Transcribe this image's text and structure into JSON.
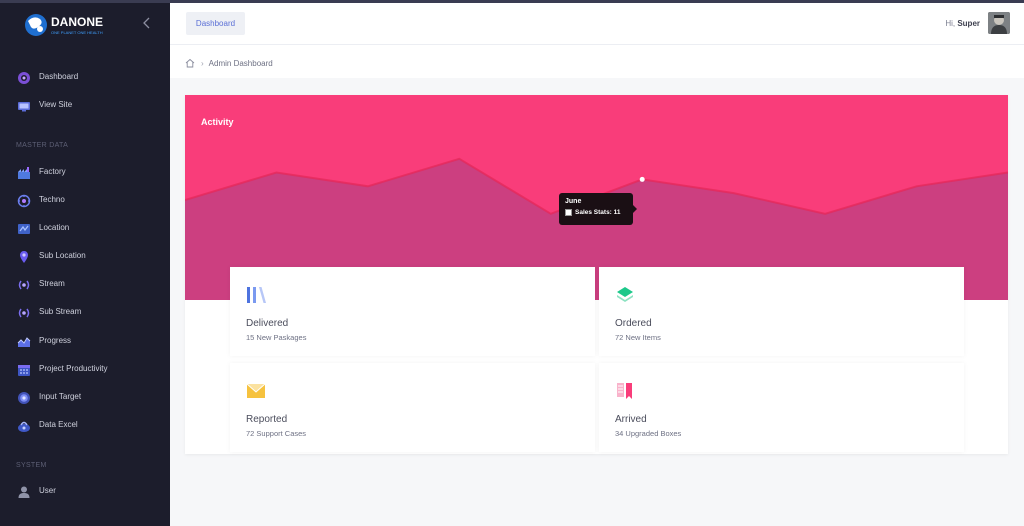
{
  "brand": {
    "name": "DANONE",
    "tagline": "ONE PLANET ONE HEALTH"
  },
  "sidebar": {
    "items": [
      {
        "label": "Dashboard",
        "icon": "dashboard-icon"
      },
      {
        "label": "View Site",
        "icon": "monitor-icon"
      }
    ],
    "sections": [
      {
        "label": "MASTER DATA",
        "items": [
          {
            "label": "Factory",
            "icon": "factory-icon"
          },
          {
            "label": "Techno",
            "icon": "techno-icon"
          },
          {
            "label": "Location",
            "icon": "location-icon"
          },
          {
            "label": "Sub Location",
            "icon": "map-pin-icon"
          },
          {
            "label": "Stream",
            "icon": "stream-icon"
          },
          {
            "label": "Sub Stream",
            "icon": "sub-stream-icon"
          },
          {
            "label": "Progress",
            "icon": "progress-chart-icon"
          },
          {
            "label": "Project Productivity",
            "icon": "calendar-icon"
          },
          {
            "label": "Input Target",
            "icon": "target-icon"
          },
          {
            "label": "Data Excel",
            "icon": "data-excel-icon"
          }
        ]
      },
      {
        "label": "SYSTEM",
        "items": [
          {
            "label": "User",
            "icon": "user-icon"
          }
        ]
      }
    ]
  },
  "topbar": {
    "tab_label": "Dashboard",
    "greeting_prefix": "Hi,",
    "user_name": "Super"
  },
  "breadcrumb": {
    "current": "Admin Dashboard"
  },
  "activity": {
    "title": "Activity",
    "tooltip": {
      "title": "June",
      "series_label": "Sales Stats: 11"
    },
    "accent_color": "#f93d7a"
  },
  "stats": [
    {
      "title": "Delivered",
      "subtitle": "15 New Paskages",
      "icon": "bars-icon",
      "color": "#4e73df"
    },
    {
      "title": "Ordered",
      "subtitle": "72 New Items",
      "icon": "diamond-stack-icon",
      "color": "#1cc88a"
    },
    {
      "title": "Reported",
      "subtitle": "72 Support Cases",
      "icon": "envelope-icon",
      "color": "#f6c23e"
    },
    {
      "title": "Arrived",
      "subtitle": "34 Upgraded Boxes",
      "icon": "bookmark-icon",
      "color": "#f93d7a"
    }
  ],
  "chart_data": {
    "type": "area",
    "x": [
      0,
      1,
      2,
      3,
      4,
      5,
      6,
      7,
      8,
      9
    ],
    "values": [
      8,
      12,
      10,
      14,
      6,
      11,
      9,
      6,
      10,
      12
    ],
    "highlight_index": 5,
    "ylim": [
      0,
      16
    ],
    "grid": false
  }
}
